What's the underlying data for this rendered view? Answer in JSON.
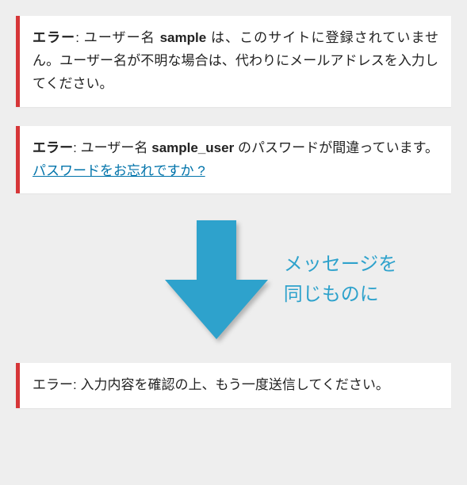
{
  "errors": {
    "e1": {
      "label": "エラー",
      "colon": ":",
      "pre": " ユーザー名 ",
      "username": "sample",
      "post": " は、このサイトに登録されていません。ユーザー名が不明な場合は、代わりにメールアドレスを入力してください。"
    },
    "e2": {
      "label": "エラー",
      "colon": ":",
      "pre": " ユーザー名 ",
      "username": "sample_user",
      "post": " のパスワードが間違っています。",
      "link": "パスワードをお忘れですか ?"
    },
    "e3": {
      "text": "エラー: 入力内容を確認の上、もう一度送信してください。"
    }
  },
  "annotation": {
    "line1": "メッセージを",
    "line2": "同じものに"
  }
}
